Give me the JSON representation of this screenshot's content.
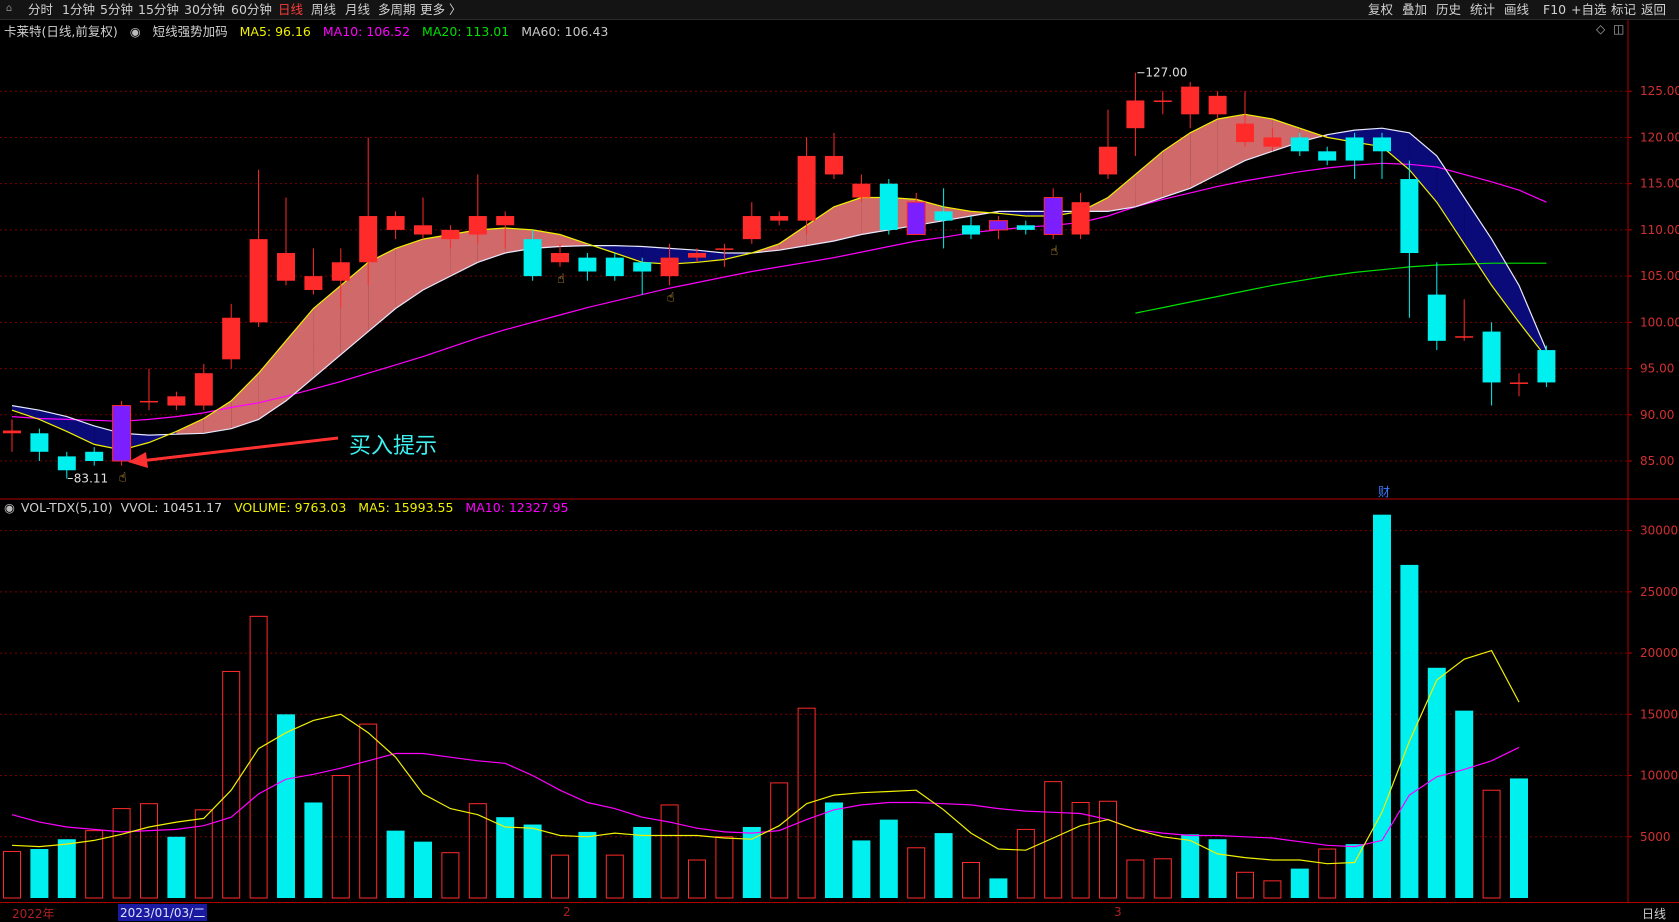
{
  "toolbar": {
    "left": [
      "分时",
      "1分钟",
      "5分钟",
      "15分钟",
      "30分钟",
      "60分钟",
      "日线",
      "周线",
      "月线",
      "多周期",
      "更多 〉"
    ],
    "active": "日线",
    "right": [
      "复权",
      "叠加",
      "历史",
      "统计",
      "画线",
      "F10",
      "+自选",
      "标记",
      "返回"
    ]
  },
  "price_legend": {
    "title": "卡莱特(日线,前复权)",
    "indicator": "短线强势加码",
    "ma5": "MA5: 96.16",
    "ma10": "MA10: 106.52",
    "ma20": "MA20: 113.01",
    "ma60": "MA60: 106.43"
  },
  "vol_legend": {
    "name": "VOL-TDX(5,10)",
    "vvol": "VVOL: 10451.17",
    "volume": "VOLUME: 9763.03",
    "ma5": "MA5: 15993.55",
    "ma10": "MA10: 12327.95"
  },
  "annotations": {
    "buy_hint": "买入提示",
    "high_label": "127.00",
    "low_label": "83.11",
    "fin_marker": "财"
  },
  "bottom": {
    "year": "2022年",
    "date": "2023/01/03/二",
    "month2": "2",
    "month3": "3",
    "period": "日线"
  },
  "colors": {
    "up": "#ff2a2a",
    "down": "#00f0f0",
    "buy_signal": "#7b1fff",
    "ma5": "#f0f000",
    "ma10": "#ff00ff",
    "ma20": "#00e000",
    "ribbon_up": "#d06a6a",
    "ribbon_down": "#0a0a78",
    "grid": "#7a0000"
  },
  "chart_data": [
    {
      "type": "candlestick",
      "title": "卡莱特(日线,前复权)",
      "ylim": [
        81,
        130
      ],
      "yticks": [
        85,
        90,
        95,
        100,
        105,
        110,
        115,
        120,
        125
      ],
      "candles": [
        {
          "o": 88.0,
          "c": 88.3,
          "h": 89.5,
          "l": 86.0,
          "t": "doji"
        },
        {
          "o": 88.0,
          "c": 86.0,
          "h": 88.5,
          "l": 85.0,
          "t": "down"
        },
        {
          "o": 85.5,
          "c": 84.0,
          "h": 86.0,
          "l": 83.11,
          "t": "down"
        },
        {
          "o": 86.0,
          "c": 85.0,
          "h": 86.5,
          "l": 84.5,
          "t": "down"
        },
        {
          "o": 85.0,
          "c": 91.0,
          "h": 91.5,
          "l": 84.5,
          "t": "buy"
        },
        {
          "o": 91.5,
          "c": 91.5,
          "h": 95.0,
          "l": 90.5,
          "t": "doji"
        },
        {
          "o": 91.0,
          "c": 92.0,
          "h": 92.5,
          "l": 90.5,
          "t": "up"
        },
        {
          "o": 91.0,
          "c": 94.5,
          "h": 95.5,
          "l": 90.5,
          "t": "up"
        },
        {
          "o": 96.0,
          "c": 100.5,
          "h": 102.0,
          "l": 95.0,
          "t": "up"
        },
        {
          "o": 100.0,
          "c": 109.0,
          "h": 116.5,
          "l": 99.5,
          "t": "up"
        },
        {
          "o": 104.5,
          "c": 107.5,
          "h": 113.5,
          "l": 104.0,
          "t": "up"
        },
        {
          "o": 103.5,
          "c": 105.0,
          "h": 108.0,
          "l": 103.0,
          "t": "up"
        },
        {
          "o": 104.5,
          "c": 106.5,
          "h": 108.0,
          "l": 101.5,
          "t": "up"
        },
        {
          "o": 106.5,
          "c": 111.5,
          "h": 120.0,
          "l": 104.0,
          "t": "up"
        },
        {
          "o": 110.0,
          "c": 111.5,
          "h": 112.0,
          "l": 109.0,
          "t": "up"
        },
        {
          "o": 109.5,
          "c": 110.5,
          "h": 113.5,
          "l": 109.0,
          "t": "up"
        },
        {
          "o": 109.0,
          "c": 110.0,
          "h": 110.5,
          "l": 108.0,
          "t": "up"
        },
        {
          "o": 109.5,
          "c": 111.5,
          "h": 116.0,
          "l": 108.5,
          "t": "up"
        },
        {
          "o": 110.5,
          "c": 111.5,
          "h": 112.0,
          "l": 108.0,
          "t": "up"
        },
        {
          "o": 109.0,
          "c": 105.0,
          "h": 110.0,
          "l": 104.5,
          "t": "down"
        },
        {
          "o": 107.5,
          "c": 106.5,
          "h": 108.5,
          "l": 106.0,
          "t": "up"
        },
        {
          "o": 107.0,
          "c": 105.5,
          "h": 107.5,
          "l": 104.5,
          "t": "down"
        },
        {
          "o": 107.0,
          "c": 105.0,
          "h": 107.5,
          "l": 104.5,
          "t": "down"
        },
        {
          "o": 106.5,
          "c": 105.5,
          "h": 107.0,
          "l": 103.0,
          "t": "down"
        },
        {
          "o": 105.0,
          "c": 107.0,
          "h": 108.5,
          "l": 104.0,
          "t": "up"
        },
        {
          "o": 107.0,
          "c": 107.5,
          "h": 108.0,
          "l": 106.5,
          "t": "up"
        },
        {
          "o": 108.0,
          "c": 108.0,
          "h": 108.5,
          "l": 106.0,
          "t": "doji"
        },
        {
          "o": 109.0,
          "c": 111.5,
          "h": 113.0,
          "l": 108.5,
          "t": "up"
        },
        {
          "o": 111.0,
          "c": 111.5,
          "h": 112.0,
          "l": 110.5,
          "t": "up"
        },
        {
          "o": 111.0,
          "c": 118.0,
          "h": 120.0,
          "l": 109.5,
          "t": "up"
        },
        {
          "o": 116.0,
          "c": 118.0,
          "h": 120.5,
          "l": 115.5,
          "t": "up"
        },
        {
          "o": 113.5,
          "c": 115.0,
          "h": 116.0,
          "l": 113.0,
          "t": "up"
        },
        {
          "o": 115.0,
          "c": 110.0,
          "h": 115.5,
          "l": 109.5,
          "t": "down"
        },
        {
          "o": 109.5,
          "c": 113.0,
          "h": 114.0,
          "l": 109.5,
          "t": "buy"
        },
        {
          "o": 112.0,
          "c": 111.0,
          "h": 114.5,
          "l": 108.0,
          "t": "down"
        },
        {
          "o": 110.5,
          "c": 109.5,
          "h": 111.5,
          "l": 109.0,
          "t": "down"
        },
        {
          "o": 110.0,
          "c": 111.0,
          "h": 111.5,
          "l": 109.0,
          "t": "buy"
        },
        {
          "o": 110.5,
          "c": 110.0,
          "h": 111.0,
          "l": 109.5,
          "t": "down"
        },
        {
          "o": 109.5,
          "c": 113.5,
          "h": 114.5,
          "l": 109.0,
          "t": "buy"
        },
        {
          "o": 109.5,
          "c": 113.0,
          "h": 114.0,
          "l": 109.0,
          "t": "up"
        },
        {
          "o": 116.0,
          "c": 119.0,
          "h": 123.0,
          "l": 115.5,
          "t": "up"
        },
        {
          "o": 121.0,
          "c": 124.0,
          "h": 127.0,
          "l": 118.0,
          "t": "up"
        },
        {
          "o": 124.0,
          "c": 124.0,
          "h": 125.0,
          "l": 122.5,
          "t": "doji"
        },
        {
          "o": 122.5,
          "c": 125.5,
          "h": 126.0,
          "l": 121.0,
          "t": "up"
        },
        {
          "o": 122.5,
          "c": 124.5,
          "h": 125.0,
          "l": 122.0,
          "t": "up"
        },
        {
          "o": 119.5,
          "c": 121.5,
          "h": 125.0,
          "l": 119.0,
          "t": "up"
        },
        {
          "o": 119.0,
          "c": 120.0,
          "h": 121.0,
          "l": 118.5,
          "t": "up"
        },
        {
          "o": 120.0,
          "c": 118.5,
          "h": 120.5,
          "l": 118.0,
          "t": "down"
        },
        {
          "o": 118.5,
          "c": 117.5,
          "h": 119.0,
          "l": 117.0,
          "t": "down"
        },
        {
          "o": 120.0,
          "c": 117.5,
          "h": 120.5,
          "l": 115.5,
          "t": "down"
        },
        {
          "o": 120.0,
          "c": 118.5,
          "h": 120.5,
          "l": 115.5,
          "t": "down"
        },
        {
          "o": 115.5,
          "c": 107.5,
          "h": 117.5,
          "l": 100.5,
          "t": "down"
        },
        {
          "o": 103.0,
          "c": 98.0,
          "h": 106.5,
          "l": 97.0,
          "t": "down"
        },
        {
          "o": 98.5,
          "c": 98.5,
          "h": 102.5,
          "l": 98.0,
          "t": "doji"
        },
        {
          "o": 99.0,
          "c": 93.5,
          "h": 100.0,
          "l": 91.0,
          "t": "down"
        },
        {
          "o": 93.5,
          "c": 93.5,
          "h": 94.5,
          "l": 92.0,
          "t": "doji"
        },
        {
          "o": 97.0,
          "c": 93.5,
          "h": 97.5,
          "l": 93.0,
          "t": "down"
        }
      ],
      "ma5": [
        90.5,
        89.5,
        88.2,
        86.8,
        86.2,
        87.0,
        88.2,
        89.6,
        91.5,
        94.5,
        98.0,
        101.5,
        104.0,
        106.5,
        108.0,
        109.0,
        109.5,
        110.0,
        110.2,
        110.0,
        109.5,
        108.5,
        107.5,
        106.5,
        106.3,
        106.5,
        106.8,
        107.5,
        108.5,
        110.5,
        112.5,
        113.5,
        113.5,
        113.3,
        112.5,
        112.0,
        111.8,
        111.5,
        111.5,
        112.0,
        113.5,
        116.0,
        118.5,
        120.5,
        122.0,
        122.5,
        122.0,
        121.0,
        120.0,
        119.5,
        119.0,
        116.5,
        113.0,
        108.5,
        104.0,
        100.0,
        96.2
      ],
      "ma10": [
        91.0,
        90.5,
        89.8,
        88.8,
        88.0,
        87.8,
        87.9,
        88.0,
        88.5,
        89.5,
        91.5,
        94.0,
        96.5,
        99.0,
        101.5,
        103.5,
        105.0,
        106.5,
        107.5,
        108.0,
        108.2,
        108.3,
        108.3,
        108.2,
        108.0,
        107.8,
        107.5,
        107.5,
        107.8,
        108.3,
        108.8,
        109.5,
        110.0,
        110.5,
        111.0,
        111.5,
        112.0,
        112.0,
        112.0,
        112.0,
        112.0,
        112.5,
        113.5,
        114.5,
        116.0,
        117.5,
        118.5,
        119.5,
        120.3,
        120.8,
        121.0,
        120.5,
        118.0,
        113.5,
        109.0,
        104.0,
        97.0
      ],
      "ma20": [
        null,
        null,
        null,
        null,
        null,
        null,
        null,
        null,
        null,
        null,
        null,
        null,
        null,
        null,
        null,
        null,
        null,
        null,
        null,
        null,
        null,
        null,
        null,
        null,
        null,
        null,
        null,
        null,
        null,
        null,
        null,
        null,
        null,
        null,
        null,
        null,
        null,
        null,
        null,
        null,
        null,
        101.0,
        101.6,
        102.2,
        102.8,
        103.4,
        104.0,
        104.5,
        105.0,
        105.4,
        105.7,
        106.0,
        106.2,
        106.3,
        106.4,
        106.4,
        106.4
      ],
      "ma60": [
        89.8,
        89.6,
        89.5,
        89.4,
        89.3,
        89.5,
        89.8,
        90.2,
        90.8,
        91.3,
        92.0,
        92.8,
        93.6,
        94.5,
        95.4,
        96.3,
        97.3,
        98.3,
        99.2,
        100.0,
        100.8,
        101.6,
        102.3,
        103.0,
        103.7,
        104.3,
        104.9,
        105.5,
        106.0,
        106.5,
        107.0,
        107.6,
        108.2,
        108.8,
        109.2,
        109.7,
        110.0,
        110.3,
        110.5,
        110.8,
        111.5,
        112.5,
        113.3,
        114.0,
        114.7,
        115.3,
        115.8,
        116.3,
        116.7,
        117.0,
        117.2,
        117.1,
        116.8,
        116.0,
        115.2,
        114.3,
        113.0
      ],
      "buy_markers": [
        4,
        20,
        24,
        38
      ],
      "annotations": [
        "127.00",
        "83.11",
        "买入提示"
      ]
    },
    {
      "type": "bar",
      "title": "VOL-TDX(5,10)",
      "ylim": [
        0,
        32500
      ],
      "yticks": [
        5000,
        10000,
        15000,
        20000,
        25000,
        30000
      ],
      "values": [
        3800,
        4000,
        4800,
        5500,
        7300,
        7700,
        5000,
        7200,
        18500,
        23000,
        15000,
        7800,
        10000,
        14200,
        5500,
        4600,
        3700,
        7700,
        6600,
        6000,
        3500,
        5400,
        3500,
        5800,
        7600,
        3100,
        5000,
        5800,
        9400,
        15500,
        7800,
        4700,
        6400,
        4100,
        5300,
        2900,
        1600,
        5600,
        9500,
        7800,
        7900,
        3100,
        3200,
        5200,
        4800,
        2100,
        1400,
        2400,
        4000,
        4400,
        31300,
        27200,
        18800,
        15300,
        8800,
        9763
      ],
      "up": [
        1,
        0,
        0,
        1,
        1,
        1,
        0,
        1,
        1,
        1,
        0,
        0,
        1,
        1,
        0,
        0,
        1,
        1,
        0,
        0,
        1,
        0,
        1,
        0,
        1,
        1,
        1,
        0,
        1,
        1,
        0,
        0,
        0,
        1,
        0,
        1,
        0,
        1,
        1,
        1,
        1,
        1,
        1,
        0,
        0,
        1,
        1,
        0,
        1,
        0,
        0,
        0,
        0,
        0,
        1,
        0
      ],
      "ma5": [
        4300,
        4200,
        4400,
        4700,
        5200,
        5800,
        6200,
        6500,
        8800,
        12200,
        13500,
        14500,
        15000,
        13500,
        11500,
        8500,
        7300,
        6800,
        5800,
        5700,
        5100,
        5000,
        5300,
        5100,
        5100,
        5100,
        4900,
        4800,
        5900,
        7700,
        8400,
        8600,
        8700,
        8800,
        7200,
        5300,
        4000,
        3900,
        4900,
        5900,
        6400,
        5600,
        5000,
        4700,
        3600,
        3300,
        3100,
        3100,
        2800,
        2900,
        7000,
        12800,
        17800,
        19500,
        20200,
        16000
      ],
      "ma10": [
        6800,
        6200,
        5800,
        5600,
        5400,
        5500,
        5600,
        5900,
        6600,
        8500,
        9700,
        10100,
        10600,
        11200,
        11800,
        11800,
        11500,
        11200,
        11000,
        10000,
        8800,
        7800,
        7300,
        6600,
        6200,
        5700,
        5400,
        5300,
        5500,
        6400,
        7200,
        7600,
        7800,
        7800,
        7700,
        7600,
        7300,
        7100,
        7000,
        6900,
        6400,
        5600,
        5300,
        5100,
        5100,
        5000,
        4900,
        4600,
        4300,
        4200,
        4700,
        8400,
        9900,
        10500,
        11200,
        12300
      ]
    }
  ]
}
